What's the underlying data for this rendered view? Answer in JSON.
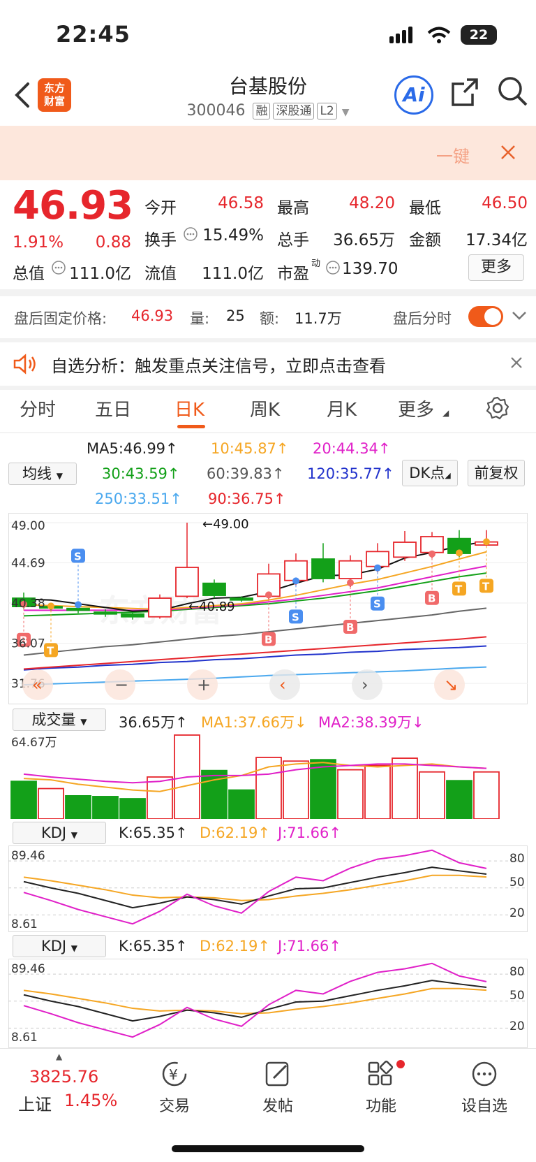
{
  "status_bar": {
    "time": "22:45",
    "battery": "22"
  },
  "header": {
    "logo_text": "东方\n财富",
    "title": "台基股份",
    "code": "300046",
    "tags": [
      "融",
      "深股通",
      "L2"
    ]
  },
  "banner": {
    "text": "一键"
  },
  "quote": {
    "price": "46.93",
    "change_pct": "1.91%",
    "change": "0.88",
    "fields": [
      {
        "label": "今开",
        "value": "46.58"
      },
      {
        "label": "最高",
        "value": "48.20"
      },
      {
        "label": "最低",
        "value": "46.50"
      },
      {
        "label": "换手",
        "value": "15.49%"
      },
      {
        "label": "总手",
        "value": "36.65万"
      },
      {
        "label": "金额",
        "value": "17.34亿"
      },
      {
        "label": "总值",
        "value": "111.0亿"
      },
      {
        "label": "流值",
        "value": "111.0亿"
      },
      {
        "label": "市盈",
        "value": "139.70"
      }
    ],
    "pe_sup": "动",
    "more_label": "更多"
  },
  "after_hours": {
    "label": "盘后固定价格:",
    "price": "46.93",
    "vol_label": "量:",
    "vol": "25",
    "amt_label": "额:",
    "amt": "11.7万",
    "toggle_label": "盘后分时",
    "toggle_on": true
  },
  "notice": {
    "text": "自选分析：触发重点关注信号，立即点击查看"
  },
  "tabs": [
    "分时",
    "五日",
    "日K",
    "周K",
    "月K",
    "更多"
  ],
  "active_tab": 2,
  "ma": {
    "selector": "均线",
    "items": [
      {
        "text": "MA5:46.99↑",
        "color": "#111111"
      },
      {
        "text": "10:45.87↑",
        "color": "#f5a623"
      },
      {
        "text": "20:44.34↑",
        "color": "#e020c8"
      },
      {
        "text": "30:43.59↑",
        "color": "#13a019"
      },
      {
        "text": "60:39.83↑",
        "color": "#555555"
      },
      {
        "text": "120:35.77↑",
        "color": "#2233cc"
      },
      {
        "text": "250:33.51↑",
        "color": "#4aa8ee"
      },
      {
        "text": "90:36.75↑",
        "color": "#e6262c"
      }
    ],
    "dk_label": "DK点",
    "fq_label": "前复权"
  },
  "kline": {
    "y_labels": [
      "49.00",
      "44.69",
      "40.38",
      "36.07",
      "31.76"
    ],
    "high_note": "←49.00",
    "low_note": "←40.89",
    "watermark": "东方财富",
    "candles": [
      {
        "o": 40.9,
        "c": 40.0,
        "h": 41.5,
        "l": 39.8
      },
      {
        "o": 40.0,
        "c": 39.9,
        "h": 40.4,
        "l": 39.6
      },
      {
        "o": 39.8,
        "c": 39.6,
        "h": 40.2,
        "l": 39.3
      },
      {
        "o": 39.4,
        "c": 39.2,
        "h": 39.7,
        "l": 38.9
      },
      {
        "o": 39.2,
        "c": 38.9,
        "h": 39.4,
        "l": 38.6
      },
      {
        "o": 38.9,
        "c": 40.9,
        "h": 41.3,
        "l": 38.7
      },
      {
        "o": 41.1,
        "c": 44.2,
        "h": 49.0,
        "l": 40.9
      },
      {
        "o": 42.5,
        "c": 41.2,
        "h": 42.9,
        "l": 40.89
      },
      {
        "o": 40.9,
        "c": 40.7,
        "h": 41.1,
        "l": 40.5
      },
      {
        "o": 41.1,
        "c": 43.5,
        "h": 44.6,
        "l": 40.8
      },
      {
        "o": 42.8,
        "c": 44.9,
        "h": 45.7,
        "l": 42.3
      },
      {
        "o": 45.1,
        "c": 43.0,
        "h": 46.8,
        "l": 42.6
      },
      {
        "o": 43.0,
        "c": 44.9,
        "h": 45.5,
        "l": 42.1
      },
      {
        "o": 44.3,
        "c": 45.9,
        "h": 46.8,
        "l": 43.7
      },
      {
        "o": 45.3,
        "c": 46.9,
        "h": 48.1,
        "l": 44.9
      },
      {
        "o": 45.8,
        "c": 47.5,
        "h": 48.0,
        "l": 45.2
      },
      {
        "o": 47.3,
        "c": 45.7,
        "h": 48.2,
        "l": 45.3
      },
      {
        "o": 46.6,
        "c": 46.93,
        "h": 48.2,
        "l": 46.5
      }
    ],
    "signals": [
      {
        "i": 0,
        "type": "B",
        "pos": "below"
      },
      {
        "i": 1,
        "type": "T",
        "pos": "below"
      },
      {
        "i": 2,
        "type": "S",
        "pos": "above"
      },
      {
        "i": 9,
        "type": "B",
        "pos": "below"
      },
      {
        "i": 10,
        "type": "S",
        "pos": "below"
      },
      {
        "i": 12,
        "type": "B",
        "pos": "below"
      },
      {
        "i": 13,
        "type": "S",
        "pos": "below"
      },
      {
        "i": 15,
        "type": "B",
        "pos": "below"
      },
      {
        "i": 16,
        "type": "T",
        "pos": "below"
      },
      {
        "i": 17,
        "type": "T",
        "pos": "below"
      }
    ],
    "controls": [
      "«",
      "−",
      "+",
      "‹",
      "›",
      "↘"
    ]
  },
  "volume": {
    "selector": "成交量",
    "value": "36.65万↑",
    "ma1": "MA1:37.66万↓",
    "ma2": "MA2:38.39万↓",
    "y_label": "64.67万"
  },
  "kdj1": {
    "selector": "KDJ",
    "k": "K:65.35↑",
    "d": "D:62.19↑",
    "j": "J:71.66↑",
    "y_top": "89.46",
    "y_bottom": "8.61",
    "levels": [
      "80",
      "50",
      "20"
    ]
  },
  "kdj2": {
    "selector": "KDJ",
    "k": "K:65.35↑",
    "d": "D:62.19↑",
    "j": "J:71.66↑",
    "y_top": "89.46",
    "y_bottom": "8.61",
    "levels": [
      "80",
      "50",
      "20"
    ]
  },
  "bottom_nav": {
    "index_value": "3825.76",
    "index_name": "上证",
    "index_pct": "1.45%",
    "items": [
      "交易",
      "发帖",
      "功能",
      "设自选"
    ]
  }
}
